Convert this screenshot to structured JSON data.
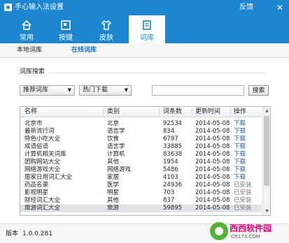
{
  "window": {
    "title": "手心输入法设置",
    "feedback": "反馈",
    "close_glyph": "✕"
  },
  "tabs": [
    {
      "label": "常用",
      "icon": "home-icon"
    },
    {
      "label": "按键",
      "icon": "keyboard-icon"
    },
    {
      "label": "皮肤",
      "icon": "shirt-icon"
    },
    {
      "label": "词库",
      "icon": "book-icon"
    }
  ],
  "active_tab": "词库",
  "subtabs": [
    {
      "label": "本地词库"
    },
    {
      "label": "在线词库"
    }
  ],
  "active_subtab": "在线词库",
  "search": {
    "group_title": "词库搜索",
    "category_value": "推荐词库",
    "sort_value": "热门下载",
    "input_value": "",
    "button_label": "搜索"
  },
  "table": {
    "columns": [
      "名称",
      "类别",
      "词条数",
      "更新时间",
      "操作"
    ],
    "rows": [
      {
        "name": "北京市",
        "category": "北京",
        "count": "92534",
        "date": "2014-05-08",
        "action": "下载"
      },
      {
        "name": "最新流行词",
        "category": "语言学",
        "count": "834",
        "date": "2014-05-08",
        "action": "下载"
      },
      {
        "name": "特色小吃大全",
        "category": "饮食",
        "count": "6797",
        "date": "2014-05-08",
        "action": "下载"
      },
      {
        "name": "成语俗语",
        "category": "语言学",
        "count": "33885",
        "date": "2014-05-08",
        "action": "下载"
      },
      {
        "name": "计算机相关词库",
        "category": "计算机",
        "count": "83638",
        "date": "2014-05-08",
        "action": "下载"
      },
      {
        "name": "团购网站大全",
        "category": "其他",
        "count": "1954",
        "date": "2014-05-08",
        "action": "下载"
      },
      {
        "name": "网络游戏大全",
        "category": "网络游戏",
        "count": "5486",
        "date": "2014-05-08",
        "action": "下载"
      },
      {
        "name": "居家日用词汇大全",
        "category": "家居",
        "count": "4103",
        "date": "2014-05-08",
        "action": "下载"
      },
      {
        "name": "药品名录",
        "category": "医学",
        "count": "24936",
        "date": "2014-05-08",
        "action": "已安装"
      },
      {
        "name": "影视明星",
        "category": "明星",
        "count": "703",
        "date": "2014-05-08",
        "action": "已安装"
      },
      {
        "name": "财经词汇大全",
        "category": "其他",
        "count": "837",
        "date": "2014-05-08",
        "action": "已安装"
      },
      {
        "name": "旅游词汇大全",
        "category": "旅游",
        "count": "59895",
        "date": "2014-05-08",
        "action": "已安装"
      }
    ]
  },
  "footer": {
    "version_label": "版本",
    "version_value": "1.0.0.281"
  },
  "watermark": {
    "text": "西西软件园",
    "sub": "CR173.COM"
  },
  "colors": {
    "accent": "#1c86d1",
    "link": "#1a5fb4",
    "installed": "#777777"
  }
}
